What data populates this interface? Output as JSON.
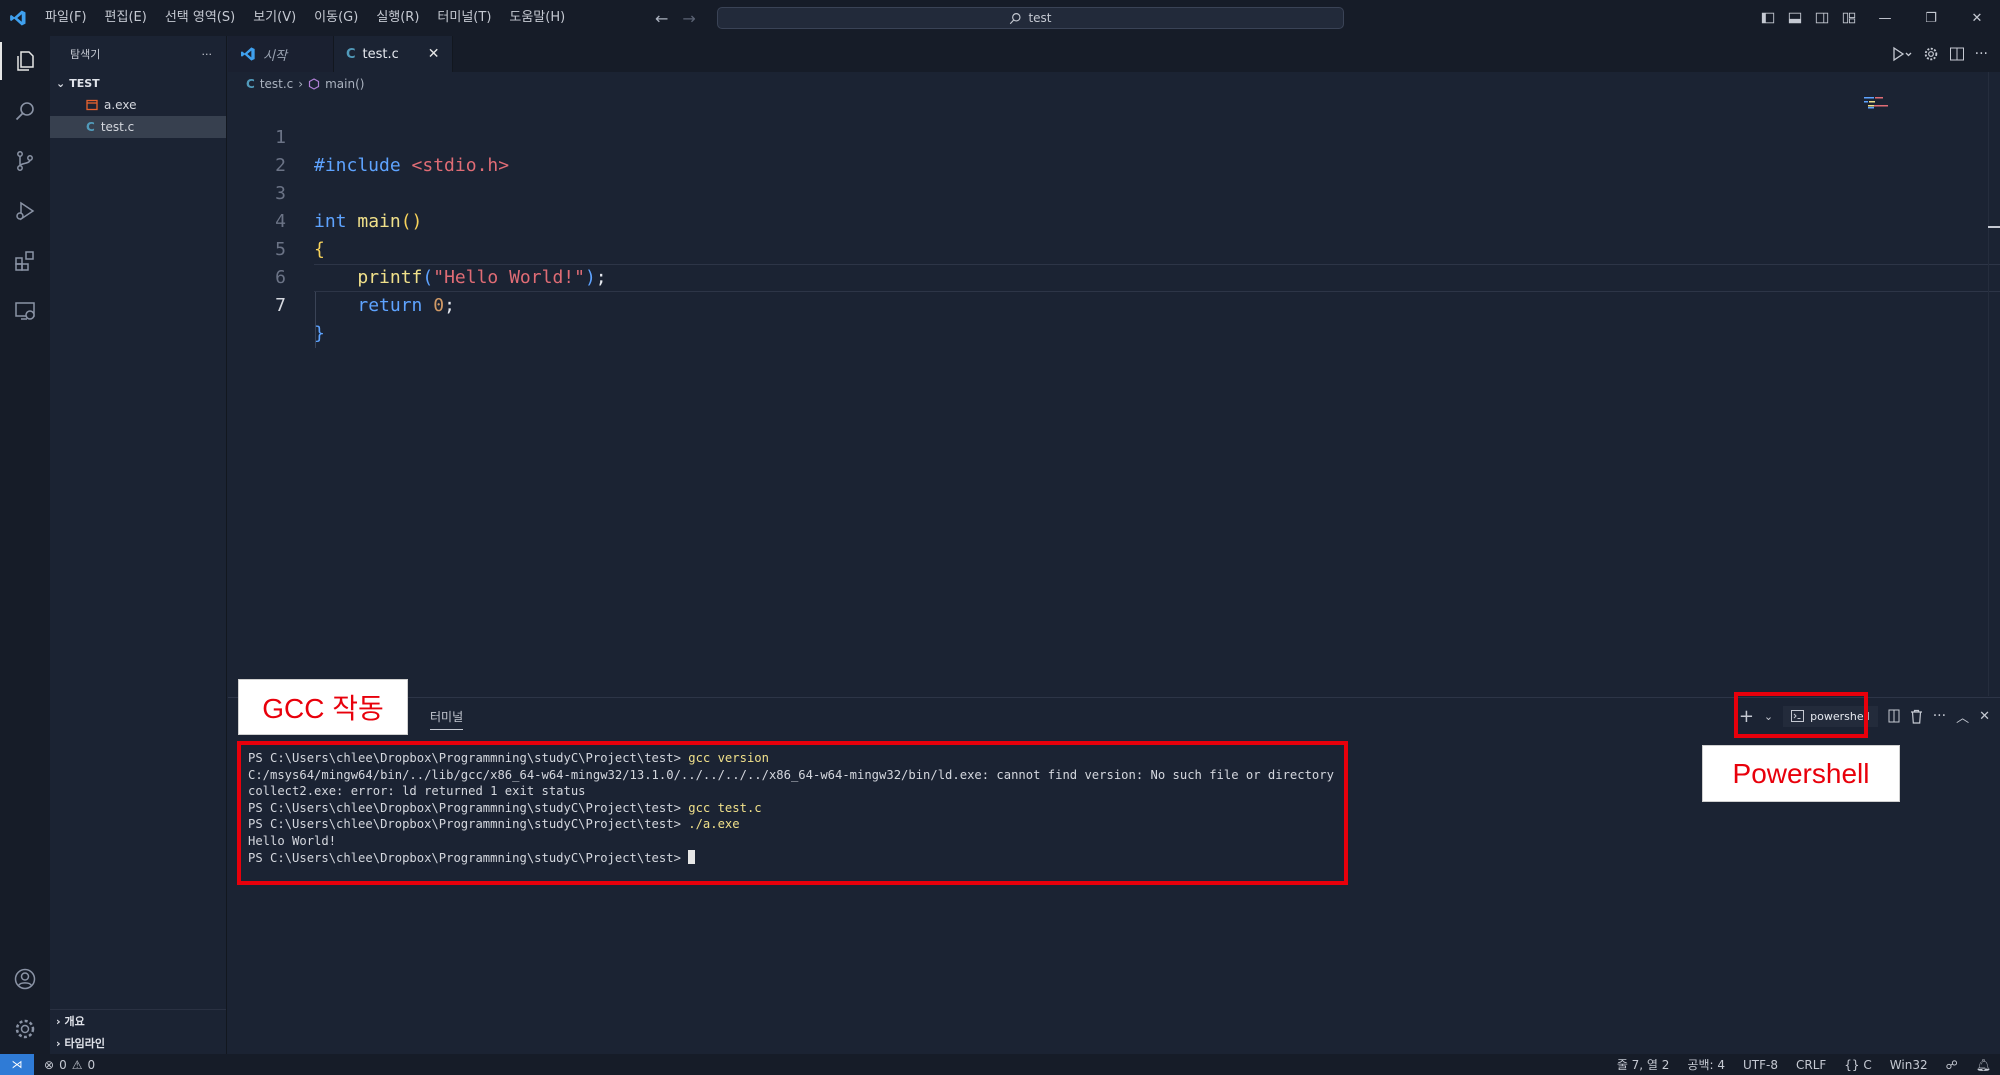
{
  "titlebar": {
    "menu": [
      "파일(F)",
      "편집(E)",
      "선택 영역(S)",
      "보기(V)",
      "이동(G)",
      "실행(R)",
      "터미널(T)",
      "도움말(H)"
    ],
    "search_text": "test"
  },
  "sidebar": {
    "title": "탐색기",
    "more": "···",
    "section": "TEST",
    "files": [
      {
        "name": "a.exe",
        "icon": "exe-file-icon"
      },
      {
        "name": "test.c",
        "icon": "c-file-icon"
      }
    ],
    "outline": "개요",
    "timeline": "타임라인"
  },
  "tabs": [
    {
      "label": "시작",
      "icon": "vscode-logo-icon"
    },
    {
      "label": "test.c",
      "icon": "c-file-icon",
      "close": "✕"
    }
  ],
  "breadcrumb": {
    "file": "test.c",
    "symbol": "main()"
  },
  "editor": {
    "line_numbers": [
      "1",
      "2",
      "3",
      "4",
      "5",
      "6",
      "7"
    ],
    "current_line": 7
  },
  "panel": {
    "tab": "터미널",
    "shell_label": "powershell",
    "terminal_lines": [
      {
        "prompt": "PS C:\\Users\\chlee\\Dropbox\\Programmning\\studyC\\Project\\test> ",
        "cmd": "gcc version"
      },
      {
        "prompt": "C:/msys64/mingw64/bin/../lib/gcc/x86_64-w64-mingw32/13.1.0/../../../../x86_64-w64-mingw32/bin/ld.exe: cannot find version: No such file or directory",
        "cmd": ""
      },
      {
        "prompt": "collect2.exe: error: ld returned 1 exit status",
        "cmd": ""
      },
      {
        "prompt": "PS C:\\Users\\chlee\\Dropbox\\Programmning\\studyC\\Project\\test> ",
        "cmd": "gcc test.c"
      },
      {
        "prompt": "PS C:\\Users\\chlee\\Dropbox\\Programmning\\studyC\\Project\\test> ",
        "cmd": "./a.exe"
      },
      {
        "prompt": "Hello World!",
        "cmd": ""
      },
      {
        "prompt": "PS C:\\Users\\chlee\\Dropbox\\Programmning\\studyC\\Project\\test> ",
        "cmd": ""
      }
    ]
  },
  "annotations": {
    "gcc_label": "GCC 작동",
    "powershell_label": "Powershell",
    "color": "#e8000b"
  },
  "statusbar": {
    "errors": "0",
    "warnings": "0",
    "position": "줄 7, 열 2",
    "spaces": "공백: 4",
    "encoding": "UTF-8",
    "eol": "CRLF",
    "language": "C",
    "platform": "Win32"
  }
}
